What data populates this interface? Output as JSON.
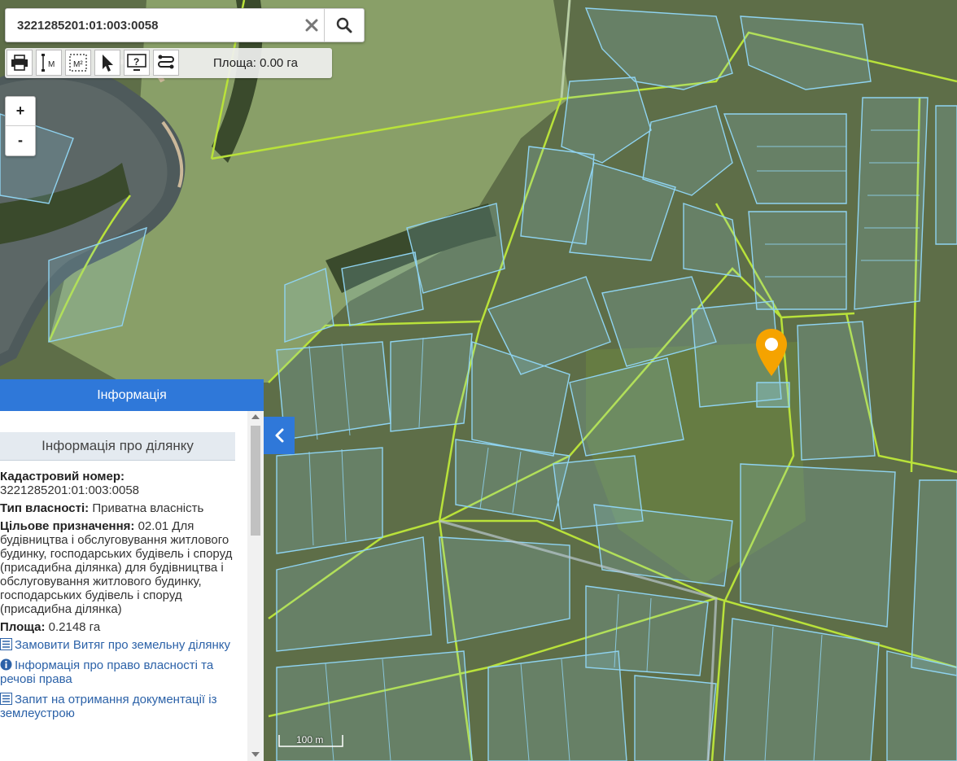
{
  "search": {
    "value": "3221285201:01:003:0058",
    "clear_icon": "close-icon",
    "search_icon": "search-icon"
  },
  "toolbar": {
    "tools": [
      "print-icon",
      "measure-length-icon",
      "measure-area-icon",
      "pointer-icon",
      "help-icon",
      "route-icon"
    ],
    "area_label": "Площа: 0.00 га"
  },
  "zoom": {
    "in_label": "+",
    "out_label": "-"
  },
  "panel": {
    "header": "Інформація",
    "section_title": "Інформація про ділянку",
    "cadastral_label": "Кадастровий номер:",
    "cadastral_value": "3221285201:01:003:0058",
    "ownership_label": "Тип власності:",
    "ownership_value": "Приватна власність",
    "purpose_label": "Цільове призначення:",
    "purpose_value": "02.01 Для будівництва і обслуговування житлового будинку, господарських будівель і споруд (присадибна ділянка) для будівництва і обслуговування житлового будинку, господарських будівель і споруд (присадибна ділянка)",
    "area_label": "Площа:",
    "area_value": "0.2148 га",
    "links": [
      {
        "label": "Замовити Витяг про земельну ділянку",
        "icon": "list-icon"
      },
      {
        "label": "Інформація про право власності та речові права",
        "icon": "info-icon"
      },
      {
        "label": "Запит на отримання документації із землеустрою",
        "icon": "list-icon"
      }
    ]
  },
  "scale": {
    "label": "100 m"
  },
  "colors": {
    "accent": "#2f78d9",
    "parcel": "#8fd3f0",
    "boundary": "#b9e23a",
    "marker": "#f5a300"
  }
}
